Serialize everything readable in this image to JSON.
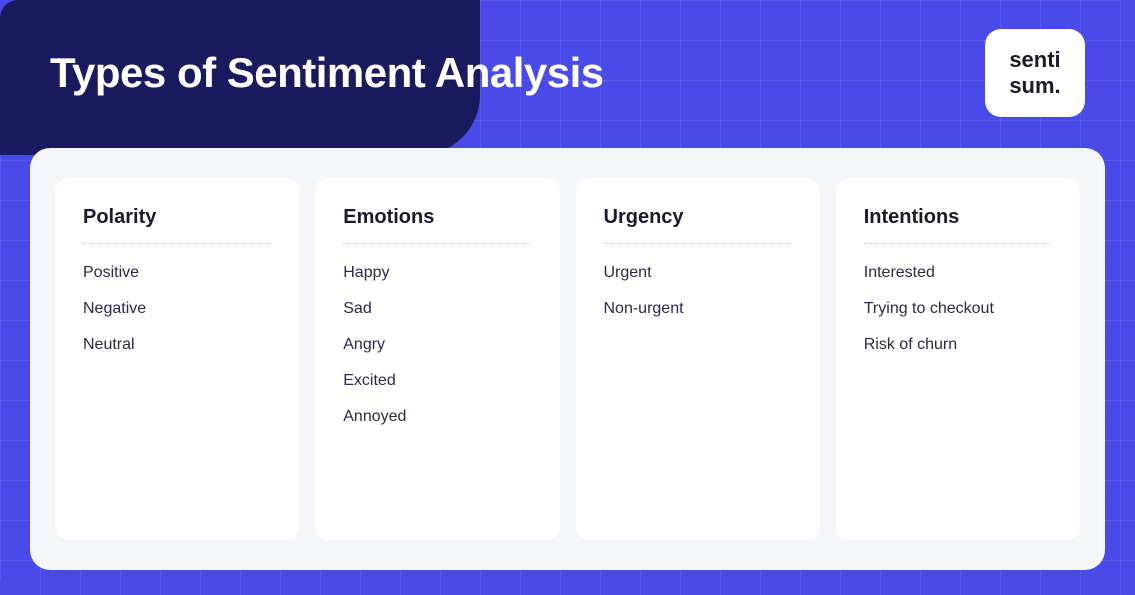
{
  "header": {
    "title": "Types of Sentiment Analysis",
    "logo_line1": "senti",
    "logo_line2": "sum.",
    "logo_dot": "."
  },
  "cards": [
    {
      "id": "polarity",
      "title": "Polarity",
      "items": [
        "Positive",
        "Negative",
        "Neutral"
      ]
    },
    {
      "id": "emotions",
      "title": "Emotions",
      "items": [
        "Happy",
        "Sad",
        "Angry",
        "Excited",
        "Annoyed"
      ]
    },
    {
      "id": "urgency",
      "title": "Urgency",
      "items": [
        "Urgent",
        "Non-urgent"
      ]
    },
    {
      "id": "intentions",
      "title": "Intentions",
      "items": [
        "Interested",
        "Trying to checkout",
        "Risk of churn"
      ]
    }
  ]
}
